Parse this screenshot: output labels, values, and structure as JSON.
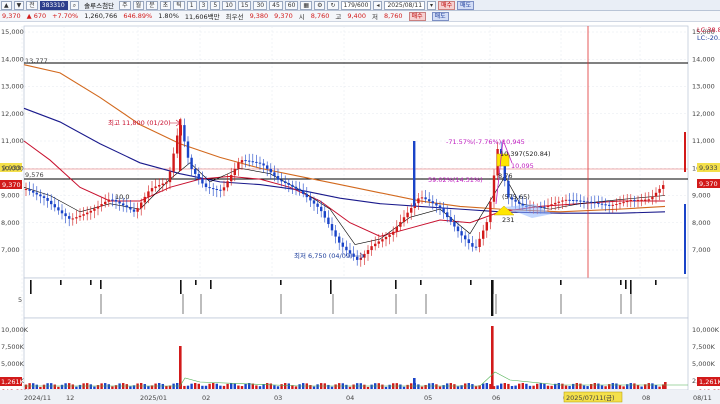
{
  "toolbar": {
    "code": "383310",
    "buttons_left": [
      "▲",
      "▼",
      "전"
    ],
    "stock_name": "솔루스첨단",
    "period_buttons": [
      "주",
      "월",
      "분",
      "초",
      "틱"
    ],
    "interval_buttons": [
      "1",
      "3",
      "5",
      "10",
      "15",
      "30",
      "45",
      "60"
    ],
    "count": "179/600",
    "date": "2025/08/11",
    "buy_label": "매수",
    "sell_label": "매도"
  },
  "quote": {
    "price": "9,370",
    "change": "670",
    "change_pct": "+7.70%",
    "volume": "1,260,766",
    "volume_ratio": "646.89%",
    "turnover_ratio": "1.80%",
    "amount": "11,606백만",
    "pref_label": "최우선",
    "ask": "9,380",
    "bid": "9,370",
    "open_label": "시",
    "open": "8,760",
    "high_label": "고",
    "high": "9,400",
    "low_label": "저",
    "low": "8,760"
  },
  "price_axis": {
    "ticks": [
      "15,000",
      "14,000",
      "13,000",
      "12,000",
      "11,000",
      "10,000",
      "9,000",
      "8,000",
      "7,000"
    ],
    "current_badge": "9,370",
    "right_badges": [
      "9,933",
      "9,370"
    ],
    "left_badges": [
      "9,933",
      "9,370"
    ],
    "left_marks": [
      "13,777",
      "9,576"
    ],
    "ma_legend_top": [
      "LC:38.81",
      "LC:-20.55"
    ]
  },
  "annotations": {
    "high_label": "최고 11,800 (01/20)",
    "low_label": "최저 6,750 (04/09)",
    "pct1": "59.02%(14.31%)",
    "pct2": "-71.57%(-7.76%)",
    "val1": "10,945",
    "val2": "10,397(520.84)",
    "val3": "10,095",
    "val4": "8,76",
    "val5": "(575.65)",
    "val6": "231",
    "minmark": "10,0"
  },
  "mid_panel": {
    "ticks": [
      "5"
    ]
  },
  "volume_axis": {
    "ticks": [
      "10,000K",
      "7,500K",
      "5,000K",
      "2,500K"
    ],
    "badge": "1,261K",
    "sub_badge": "646.89%",
    "left_badge": "1,261K",
    "left_sub": "646.89%"
  },
  "x_axis": {
    "labels": [
      "2024/11",
      "12",
      "2025/01",
      "02",
      "03",
      "04",
      "05",
      "06",
      "07",
      "08"
    ],
    "crosshair_label": "2025/07/11(금)",
    "end_label": "08/11"
  },
  "colors": {
    "up": "#d21a1a",
    "down": "#1a44c8",
    "ma5": "#000000",
    "ma20": "#c8102e",
    "ma60": "#1a1a8c",
    "ma120": "#d2691e",
    "crosshair": "#e03030"
  }
}
